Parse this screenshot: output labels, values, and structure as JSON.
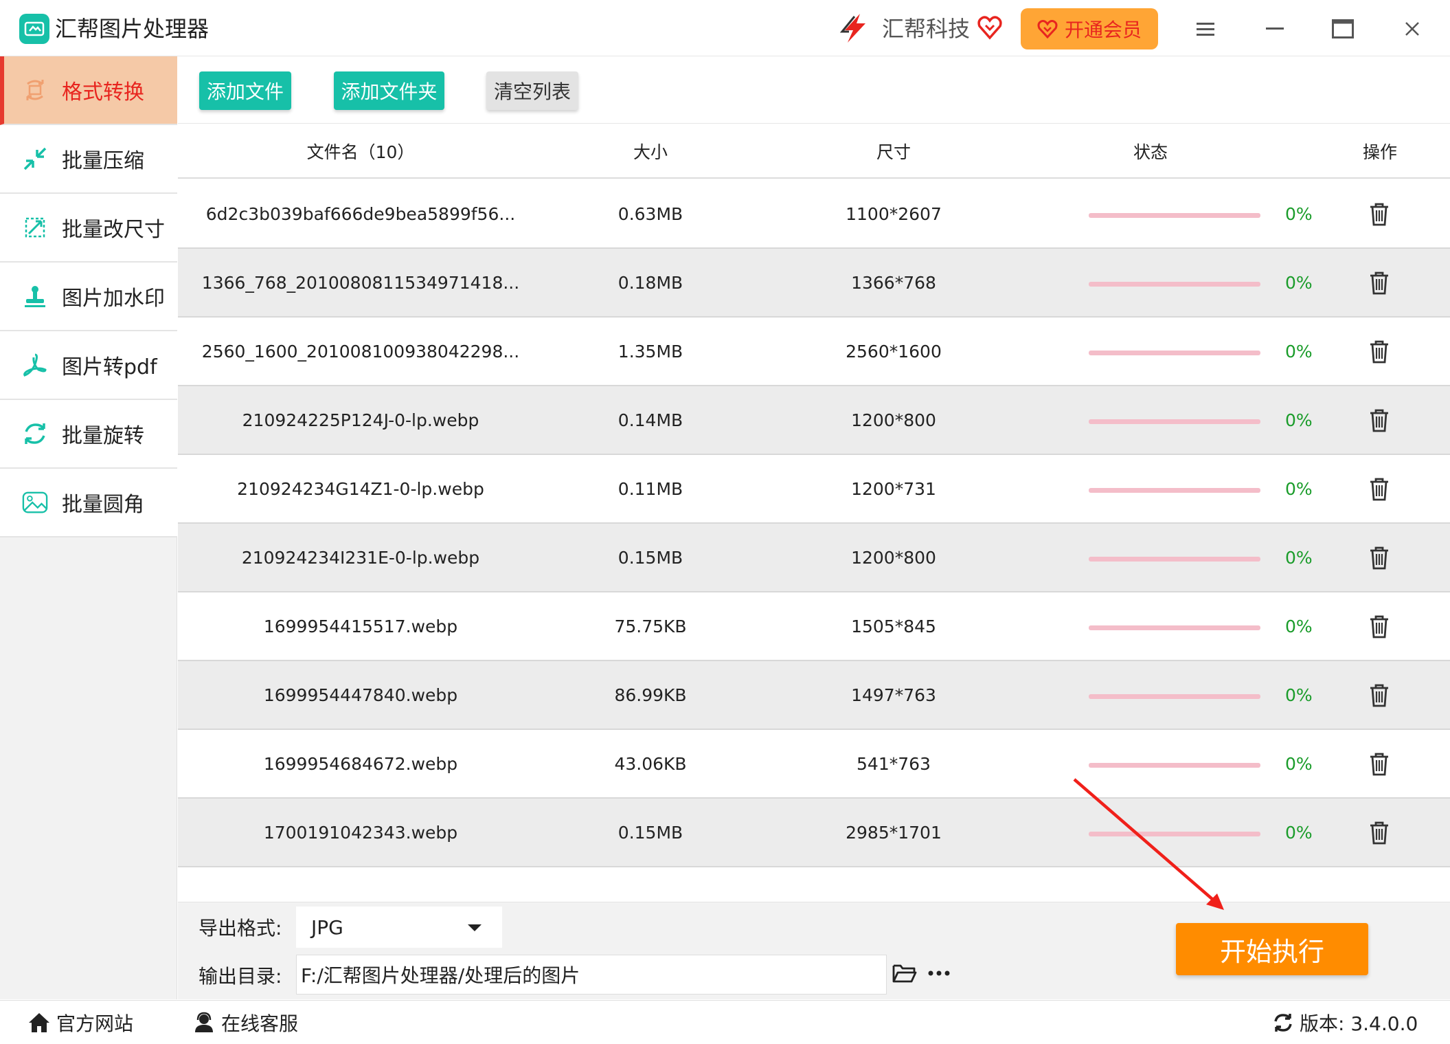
{
  "titlebar": {
    "app_title": "汇帮图片处理器",
    "brand_name": "汇帮科技",
    "vip_label": "开通会员",
    "accent_color": "#17c0a8",
    "vip_color": "#ffa535"
  },
  "sidebar": {
    "items": [
      {
        "label": "格式转换",
        "icon": "format-convert-icon",
        "active": true
      },
      {
        "label": "批量压缩",
        "icon": "compress-icon",
        "active": false
      },
      {
        "label": "批量改尺寸",
        "icon": "resize-icon",
        "active": false
      },
      {
        "label": "图片加水印",
        "icon": "watermark-stamp-icon",
        "active": false
      },
      {
        "label": "图片转pdf",
        "icon": "pdf-icon",
        "active": false
      },
      {
        "label": "批量旋转",
        "icon": "rotate-icon",
        "active": false
      },
      {
        "label": "批量圆角",
        "icon": "rounded-image-icon",
        "active": false
      }
    ]
  },
  "toolbar": {
    "add_file": "添加文件",
    "add_folder": "添加文件夹",
    "clear_list": "清空列表"
  },
  "table": {
    "headers": {
      "filename": "文件名（10）",
      "size": "大小",
      "dimensions": "尺寸",
      "status": "状态",
      "action": "操作"
    },
    "rows": [
      {
        "name": "6d2c3b039baf666de9bea5899f56...",
        "size": "0.63MB",
        "dim": "1100*2607",
        "progress": 0,
        "pct": "0%"
      },
      {
        "name": "1366_768_2010080811534971418...",
        "size": "0.18MB",
        "dim": "1366*768",
        "progress": 0,
        "pct": "0%"
      },
      {
        "name": "2560_1600_201008100938042298...",
        "size": "1.35MB",
        "dim": "2560*1600",
        "progress": 0,
        "pct": "0%"
      },
      {
        "name": "210924225P124J-0-lp.webp",
        "size": "0.14MB",
        "dim": "1200*800",
        "progress": 0,
        "pct": "0%"
      },
      {
        "name": "210924234G14Z1-0-lp.webp",
        "size": "0.11MB",
        "dim": "1200*731",
        "progress": 0,
        "pct": "0%"
      },
      {
        "name": "210924234I231E-0-lp.webp",
        "size": "0.15MB",
        "dim": "1200*800",
        "progress": 0,
        "pct": "0%"
      },
      {
        "name": "1699954415517.webp",
        "size": "75.75KB",
        "dim": "1505*845",
        "progress": 0,
        "pct": "0%"
      },
      {
        "name": "1699954447840.webp",
        "size": "86.99KB",
        "dim": "1497*763",
        "progress": 0,
        "pct": "0%"
      },
      {
        "name": "1699954684672.webp",
        "size": "43.06KB",
        "dim": "541*763",
        "progress": 0,
        "pct": "0%"
      },
      {
        "name": "1700191042343.webp",
        "size": "0.15MB",
        "dim": "2985*1701",
        "progress": 0,
        "pct": "0%"
      }
    ]
  },
  "settings": {
    "format_label": "导出格式:",
    "format_value": "JPG",
    "dir_label": "输出目录:",
    "dir_value": "F:/汇帮图片处理器/处理后的图片",
    "start_label": "开始执行"
  },
  "bottombar": {
    "website": "官方网站",
    "support": "在线客服",
    "version": "版本: 3.4.0.0"
  }
}
